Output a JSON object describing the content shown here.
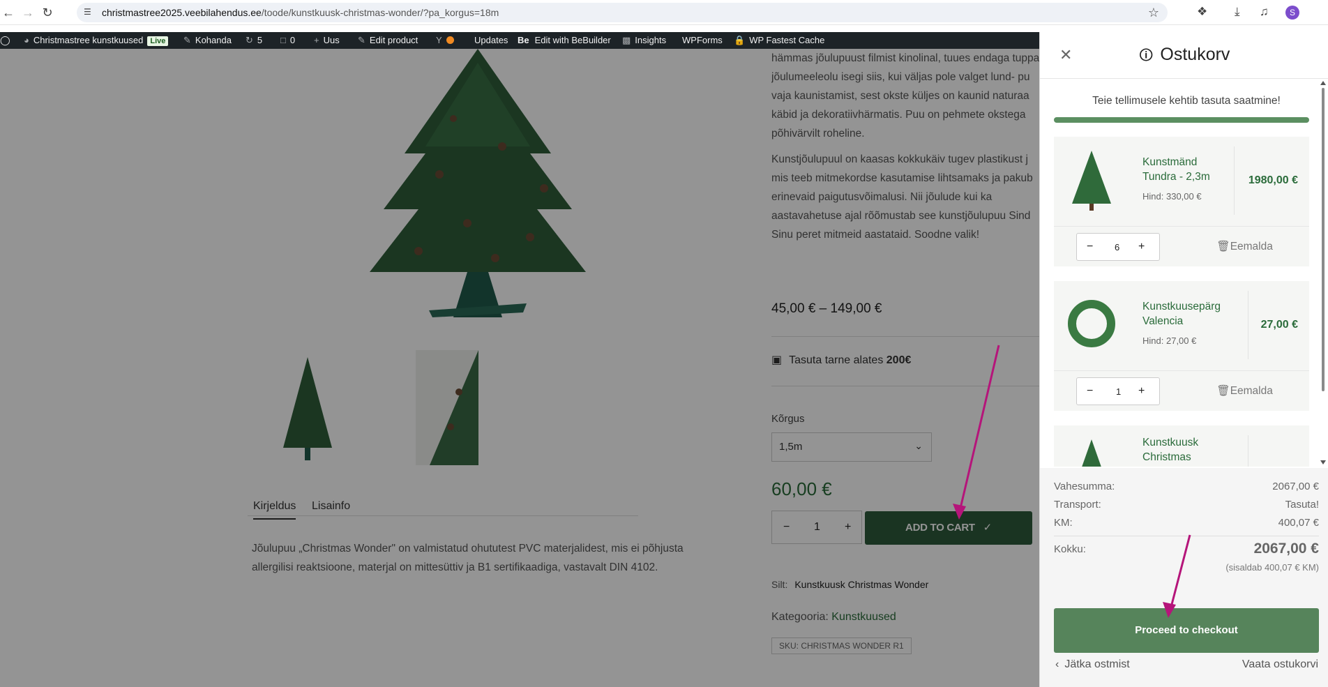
{
  "browser": {
    "url_domain": "christmastree2025.veebilahendus.ee",
    "url_path": "/toode/kunstkuusk-christmas-wonder/?pa_korgus=18m",
    "profile_initial": "S"
  },
  "adminbar": {
    "site_name": "Christmastree kunstkuused",
    "live_badge": "Live",
    "customize": "Kohanda",
    "updates_count": "5",
    "comments_count": "0",
    "new": "Uus",
    "edit_product": "Edit product",
    "updates": "Updates",
    "bebuilder": "Edit with BeBuilder",
    "insights": "Insights",
    "wpforms": "WPForms",
    "fastest_cache": "WP Fastest Cache"
  },
  "product": {
    "desc_right_1": "hämmas jõulupuust filmist kinolinal, tuues endaga tuppa",
    "desc_right_2": "jõulumeeleolu isegi siis, kui väljas pole valget lund- pu",
    "desc_right_3": "vaja kaunistamist, sest okste küljes on kaunid naturaa",
    "desc_right_4": "käbid ja dekoratiivhärmatis. Puu on pehmete okstega",
    "desc_right_5": "põhivärvilt roheline.",
    "desc_right_6": "Kunstjõulupuul on kaasas kokkukäiv tugev plastikust j",
    "desc_right_7": "mis teeb mitmekordse kasutamise lihtsamaks ja pakub",
    "desc_right_8": "erinevaid paigutusvõimalusi. Nii jõulude kui ka",
    "desc_right_9": "aastavahetuse ajal rõõmustab see kunstjõulupuu Sind",
    "desc_right_10": "Sinu peret mitmeid aastataid. Soodne valik!",
    "price_range": "45,00 € – 149,00 €",
    "shipping_text": "Tasuta tarne alates ",
    "shipping_amount": "200€",
    "height_label": "Kõrgus",
    "height_value": "1,5m",
    "price": "60,00 €",
    "qty": "1",
    "add_to_cart": "ADD TO CART",
    "tag_label": "Silt:",
    "tag_value": "Kunstkuusk Christmas Wonder",
    "category_label": "Kategooria:",
    "category_value": "Kunstkuused",
    "sku": "SKU: CHRISTMAS WONDER R1",
    "tab_description": "Kirjeldus",
    "tab_info": "Lisainfo",
    "description_line1": "Jõulupuu „Christmas Wonder\" on valmistatud ohututest PVC materjalidest, mis ei põhjusta",
    "description_line2": "allergilisi reaktsioone, materjal on mittesüttiv ja B1 sertifikaadiga, vastavalt DIN 4102."
  },
  "cart": {
    "title": "Ostukorv",
    "free_shipping_msg": "Teie tellimusele kehtib tasuta saatmine!",
    "free_shipping_progress": 1,
    "remove_label": "Eemalda",
    "items": [
      {
        "name_1": "Kunstmänd",
        "name_2": "Tundra - 2,3m",
        "unit_label": "Hind:",
        "unit_price": "330,00 €",
        "total": "1980,00 €",
        "qty": "6"
      },
      {
        "name_1": "Kunstkuusepärg",
        "name_2": "Valencia",
        "unit_label": "Hind:",
        "unit_price": "27,00 €",
        "total": "27,00 €",
        "qty": "1"
      },
      {
        "name_1": "Kunstkuusk",
        "name_2": "Christmas"
      }
    ],
    "subtotal_label": "Vahesumma:",
    "subtotal": "2067,00 €",
    "transport_label": "Transport:",
    "transport": "Tasuta!",
    "vat_label": "KM:",
    "vat": "400,07 €",
    "total_label": "Kokku:",
    "total": "2067,00 €",
    "vat_note": "(sisaldab 400,07 € KM)",
    "checkout": "Proceed to checkout",
    "continue_shopping": "Jätka ostmist",
    "view_cart": "Vaata ostukorvi"
  },
  "colors": {
    "brand_green": "#56845b",
    "dark_green": "#2e5a3c",
    "annotation_arrow": "#b5157a"
  },
  "icons": [
    "back-icon",
    "forward-icon",
    "reload-icon",
    "tune-icon",
    "star-icon",
    "extensions-icon",
    "download-icon",
    "media-icon",
    "wordpress-icon",
    "close-icon",
    "bag-icon",
    "trash-icon",
    "box-icon",
    "chevron-down-icon",
    "check-icon",
    "chevron-left-icon"
  ]
}
